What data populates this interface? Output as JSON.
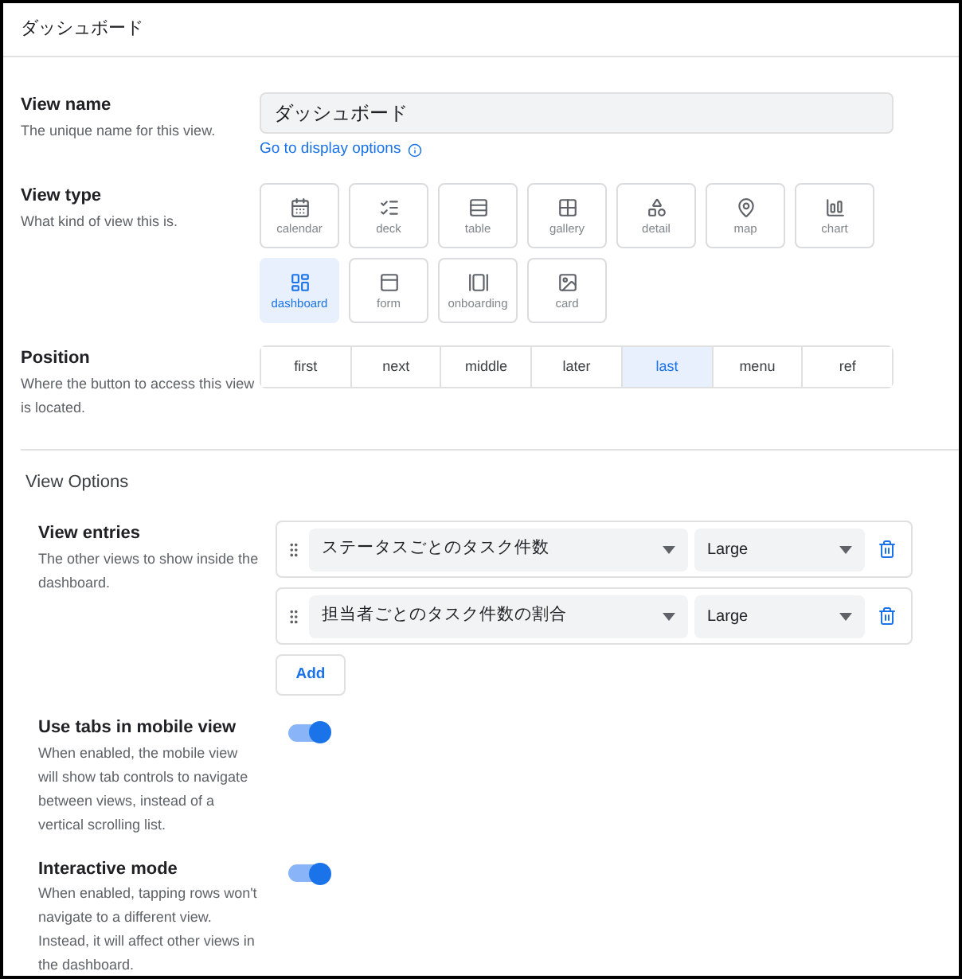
{
  "header": {
    "title": "ダッシュボード"
  },
  "view_name": {
    "label": "View name",
    "description": "The unique name for this view.",
    "value": "ダッシュボード",
    "link": "Go to display options"
  },
  "view_type": {
    "label": "View type",
    "description": "What kind of view this is.",
    "options": [
      {
        "label": "calendar",
        "selected": false
      },
      {
        "label": "deck",
        "selected": false
      },
      {
        "label": "table",
        "selected": false
      },
      {
        "label": "gallery",
        "selected": false
      },
      {
        "label": "detail",
        "selected": false
      },
      {
        "label": "map",
        "selected": false
      },
      {
        "label": "chart",
        "selected": false
      },
      {
        "label": "dashboard",
        "selected": true
      },
      {
        "label": "form",
        "selected": false
      },
      {
        "label": "onboarding",
        "selected": false
      },
      {
        "label": "card",
        "selected": false
      }
    ]
  },
  "position": {
    "label": "Position",
    "description": "Where the button to access this view is located.",
    "options": [
      {
        "label": "first",
        "selected": false
      },
      {
        "label": "next",
        "selected": false
      },
      {
        "label": "middle",
        "selected": false
      },
      {
        "label": "later",
        "selected": false
      },
      {
        "label": "last",
        "selected": true
      },
      {
        "label": "menu",
        "selected": false
      },
      {
        "label": "ref",
        "selected": false
      }
    ]
  },
  "view_options": {
    "title": "View Options",
    "view_entries": {
      "label": "View entries",
      "description": "The other views to show inside the dashboard.",
      "entries": [
        {
          "view": "ステータスごとのタスク件数",
          "size": "Large"
        },
        {
          "view": "担当者ごとのタスク件数の割合",
          "size": "Large"
        }
      ],
      "add_button": "Add"
    },
    "toggles": [
      {
        "label": "Use tabs in mobile view",
        "description": "When enabled, the mobile view will show tab controls to navigate between views, instead of a vertical scrolling list.",
        "on": true
      },
      {
        "label": "Interactive mode",
        "description": "When enabled, tapping rows won't navigate to a different view. Instead, it will affect other views in the dashboard.",
        "on": true
      }
    ]
  }
}
